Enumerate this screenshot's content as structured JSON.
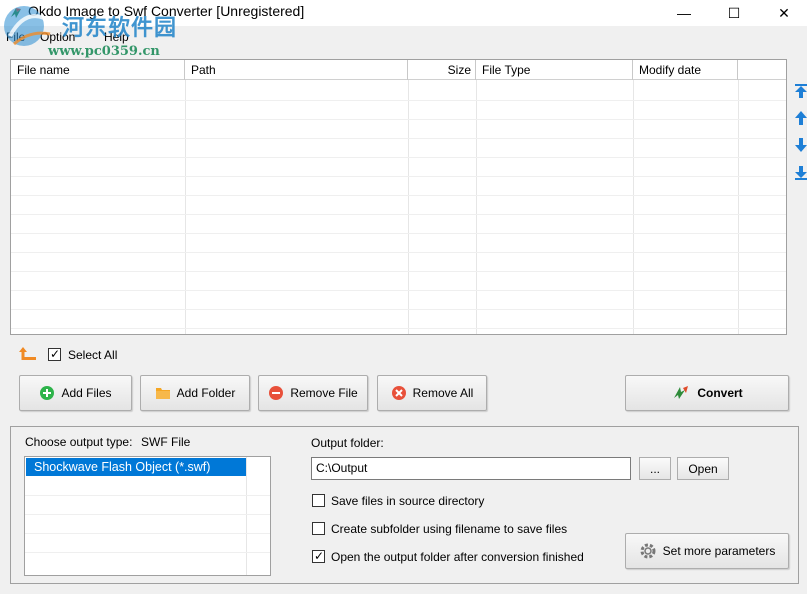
{
  "window": {
    "title": "Okdo Image to Swf Converter [Unregistered]",
    "minimize_glyph": "—",
    "maximize_glyph": "☐",
    "close_glyph": "✕"
  },
  "menu": {
    "items": [
      "File",
      "Option",
      "Help"
    ]
  },
  "watermark": {
    "text": "河东软件园",
    "url": "www.pc0359.cn"
  },
  "file_list": {
    "columns": [
      "File name",
      "Path",
      "Size",
      "File Type",
      "Modify date"
    ],
    "rows": []
  },
  "select_all": {
    "label": "Select All",
    "checked": true
  },
  "toolbar": {
    "add_files": "Add Files",
    "add_folder": "Add Folder",
    "remove_file": "Remove File",
    "remove_all": "Remove All",
    "convert": "Convert"
  },
  "output": {
    "type_label": "Choose output type:",
    "type_value": "SWF File",
    "type_options": [
      "Shockwave Flash Object (*.swf)"
    ],
    "folder_label": "Output folder:",
    "folder_value": "C:\\Output",
    "browse_label": "...",
    "open_label": "Open",
    "options": [
      {
        "label": "Save files in source directory",
        "checked": false
      },
      {
        "label": "Create subfolder using filename to save files",
        "checked": false
      },
      {
        "label": "Open the output folder after conversion finished",
        "checked": true
      }
    ],
    "more_params_label": "Set more parameters"
  },
  "colors": {
    "selection": "#0078d7",
    "arrow_blue": "#1e7fd6",
    "add_green": "#2db34a",
    "remove_red": "#e8503a",
    "folder_orange": "#f5a623"
  }
}
